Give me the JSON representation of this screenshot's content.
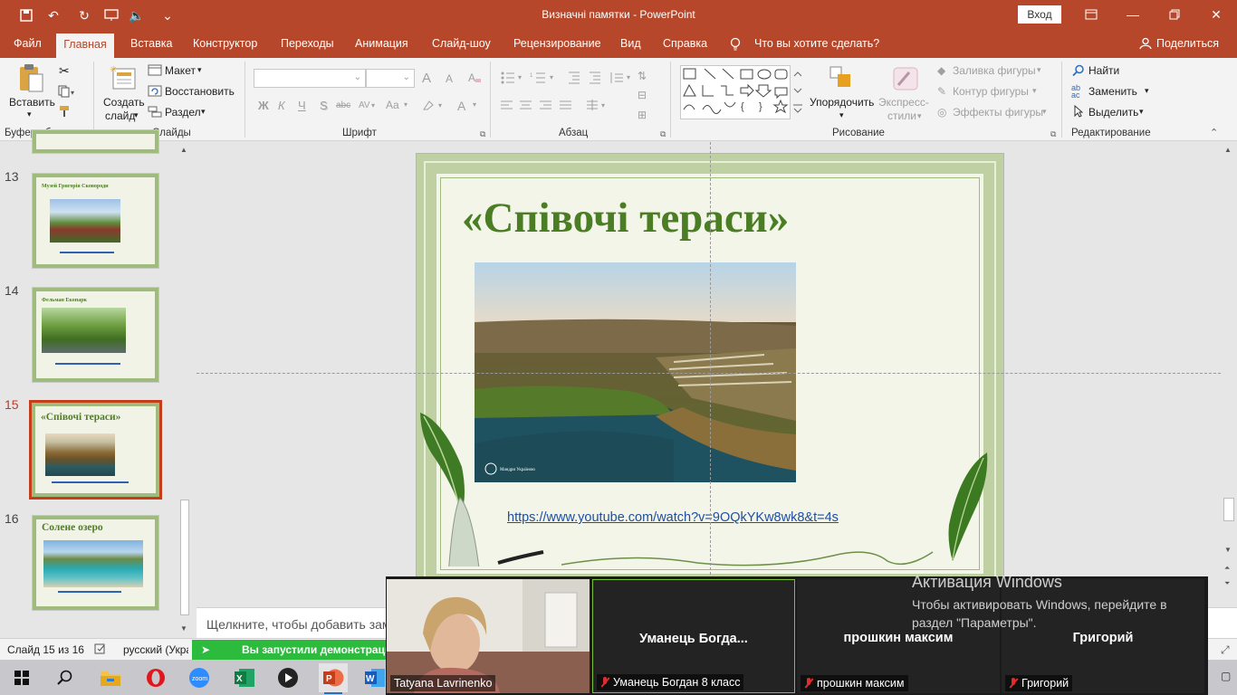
{
  "window": {
    "doc_title": "Визначні памятки  -  PowerPoint",
    "signin": "Вход",
    "min_icon": "—",
    "close_icon": "✕"
  },
  "menu": {
    "tabs": [
      "Файл",
      "Главная",
      "Вставка",
      "Конструктор",
      "Переходы",
      "Анимация",
      "Слайд-шоу",
      "Рецензирование",
      "Вид",
      "Справка"
    ],
    "tell_me": "Что вы хотите сделать?",
    "share": "Поделиться"
  },
  "ribbon": {
    "clipboard": {
      "label": "Буфер обмена",
      "paste": "Вставить"
    },
    "slides": {
      "label": "Слайды",
      "new_slide_1": "Создать",
      "new_slide_2": "слайд",
      "layout": "Макет",
      "reset": "Восстановить",
      "section": "Раздел"
    },
    "font": {
      "label": "Шрифт",
      "bold": "Ж",
      "italic": "К",
      "underline": "Ч",
      "strike": "S",
      "abc": "abc",
      "size_up": "A",
      "size_down": "A",
      "case": "Aa",
      "color": "A"
    },
    "paragraph": {
      "label": "Абзац"
    },
    "drawing": {
      "label": "Рисование",
      "arrange": "Упорядочить",
      "quick_styles_1": "Экспресс-",
      "quick_styles_2": "стили",
      "fill": "Заливка фигуры",
      "outline": "Контур фигуры",
      "effects": "Эффекты фигуры"
    },
    "editing": {
      "label": "Редактирование",
      "find": "Найти",
      "replace": "Заменить",
      "select": "Выделить"
    }
  },
  "thumbnails": [
    {
      "num": "13",
      "title": "Музей Григорія Сковороди",
      "selected": false
    },
    {
      "num": "14",
      "title": "Фельман Екопарк",
      "selected": false
    },
    {
      "num": "15",
      "title": "«Співочі тераси»",
      "selected": true
    },
    {
      "num": "16",
      "title": "Солене озеро",
      "selected": false
    }
  ],
  "slide": {
    "title": "«Співочі тераси»",
    "link": "https://www.youtube.com/watch?v=9OQkYKw8wk8&t=4s",
    "photo_caption": "Мандри Україною"
  },
  "notes": {
    "placeholder": "Щелкните, чтобы добавить заметки"
  },
  "status": {
    "slide": "Слайд 15 из 16",
    "lang": "русский (Украина)",
    "sharing": "Вы запустили демонстрацию"
  },
  "zoom": {
    "participants": [
      {
        "label": "Tatyana Lavrinenko",
        "name": "",
        "muted": false
      },
      {
        "label": "Уманець Богдан 8 класс",
        "name": "Уманець  Богда...",
        "muted": true
      },
      {
        "label": "прошкин максим",
        "name": "прошкин максим",
        "muted": true
      },
      {
        "label": "Григорий",
        "name": "Григорий",
        "muted": true
      }
    ]
  },
  "watermark": {
    "title": "Активация Windows",
    "line1": "Чтобы активировать Windows, перейдите в",
    "line2": "раздел \"Параметры\"."
  },
  "colors": {
    "accent": "#b7472a",
    "slide_title": "#4a7d24",
    "link": "#1f4ea3",
    "sharing": "#2dbb3d"
  }
}
